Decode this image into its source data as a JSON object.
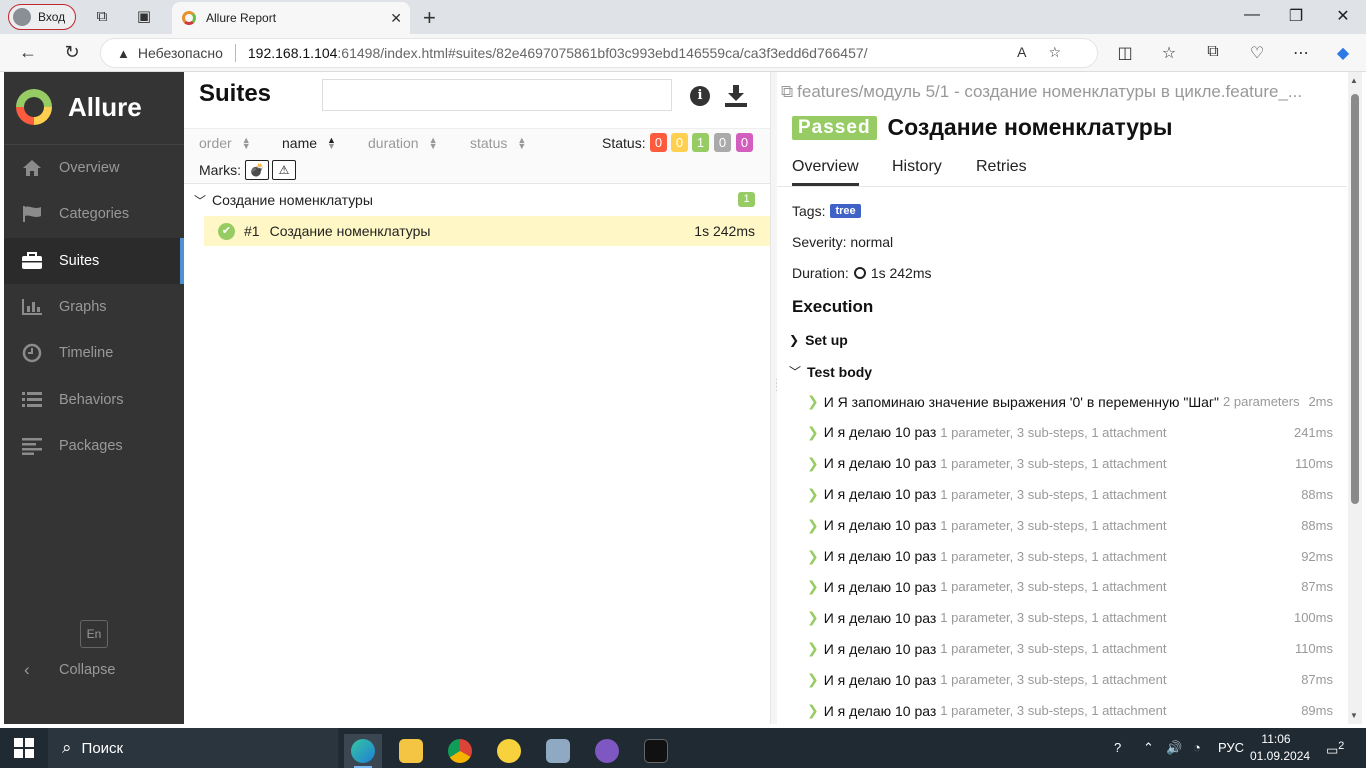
{
  "browser": {
    "profile_label": "Вход",
    "tab_title": "Allure Report",
    "insecure_label": "Небезопасно",
    "url_host": "192.168.1.104",
    "url_path": ":61498/index.html#suites/82e4697075861bf03c993ebd146559ca/ca3f3edd6d766457/"
  },
  "sidebar": {
    "brand": "Allure",
    "items": [
      {
        "label": "Overview",
        "icon": "home-icon"
      },
      {
        "label": "Categories",
        "icon": "flag-icon"
      },
      {
        "label": "Suites",
        "icon": "briefcase-icon"
      },
      {
        "label": "Graphs",
        "icon": "bar-chart-icon"
      },
      {
        "label": "Timeline",
        "icon": "clock-icon"
      },
      {
        "label": "Behaviors",
        "icon": "list-icon"
      },
      {
        "label": "Packages",
        "icon": "align-left-icon"
      }
    ],
    "active": "Suites",
    "lang": "En",
    "collapse": "Collapse"
  },
  "suites": {
    "title": "Suites",
    "sort": {
      "order": "order",
      "name": "name",
      "duration": "duration",
      "status": "status"
    },
    "status_label": "Status:",
    "status_counts": [
      {
        "value": "0",
        "color": "#fd5a3e"
      },
      {
        "value": "0",
        "color": "#ffd050"
      },
      {
        "value": "1",
        "color": "#97cc64"
      },
      {
        "value": "0",
        "color": "#aaaaaa"
      },
      {
        "value": "0",
        "color": "#d35ebe"
      }
    ],
    "marks_label": "Marks:",
    "group": {
      "name": "Создание номенклатуры",
      "count": "1"
    },
    "case": {
      "num": "#1",
      "name": "Создание номенклатуры",
      "duration": "1s 242ms"
    }
  },
  "detail": {
    "breadcrumb": "features/модуль 5/1 - создание номенклатуры в цикле.feature_...",
    "status": "Passed",
    "title": "Создание номенклатуры",
    "tabs": [
      "Overview",
      "History",
      "Retries"
    ],
    "tags_label": "Tags:",
    "tag": "tree",
    "severity": "Severity: normal",
    "duration_label": "Duration:",
    "duration": "1s 242ms",
    "execution": "Execution",
    "setup": "Set up",
    "test_body": "Test body",
    "steps": [
      {
        "name": "И Я запоминаю значение выражения '0' в переменную \"Шаг\"",
        "meta": "2 parameters",
        "duration": "2ms"
      },
      {
        "name": "И я делаю 10 раз",
        "meta": "1 parameter, 3 sub-steps, 1 attachment",
        "duration": "241ms"
      },
      {
        "name": "И я делаю 10 раз",
        "meta": "1 parameter, 3 sub-steps, 1 attachment",
        "duration": "110ms"
      },
      {
        "name": "И я делаю 10 раз",
        "meta": "1 parameter, 3 sub-steps, 1 attachment",
        "duration": "88ms"
      },
      {
        "name": "И я делаю 10 раз",
        "meta": "1 parameter, 3 sub-steps, 1 attachment",
        "duration": "88ms"
      },
      {
        "name": "И я делаю 10 раз",
        "meta": "1 parameter, 3 sub-steps, 1 attachment",
        "duration": "92ms"
      },
      {
        "name": "И я делаю 10 раз",
        "meta": "1 parameter, 3 sub-steps, 1 attachment",
        "duration": "87ms"
      },
      {
        "name": "И я делаю 10 раз",
        "meta": "1 parameter, 3 sub-steps, 1 attachment",
        "duration": "100ms"
      },
      {
        "name": "И я делаю 10 раз",
        "meta": "1 parameter, 3 sub-steps, 1 attachment",
        "duration": "110ms"
      },
      {
        "name": "И я делаю 10 раз",
        "meta": "1 parameter, 3 sub-steps, 1 attachment",
        "duration": "87ms"
      },
      {
        "name": "И я делаю 10 раз",
        "meta": "1 parameter, 3 sub-steps, 1 attachment",
        "duration": "89ms"
      }
    ]
  },
  "taskbar": {
    "search": "Поиск",
    "lang": "РУС",
    "time": "11:06",
    "date": "01.09.2024",
    "notif_count": "2"
  }
}
